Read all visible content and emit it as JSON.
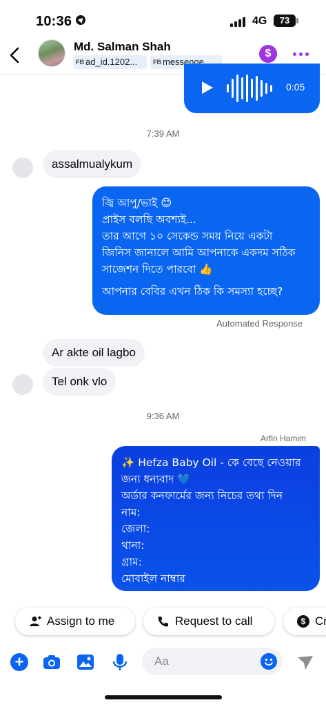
{
  "status_bar": {
    "time": "10:36",
    "network": "4G",
    "battery": "73"
  },
  "header": {
    "contact_name": "Md. Salman Shah",
    "tags": [
      {
        "prefix": "FB",
        "text": "ad_id.1202..."
      },
      {
        "prefix": "FB",
        "text": "messenge..."
      }
    ],
    "accent_color": "#a033e0"
  },
  "audio_message": {
    "duration": "0:05"
  },
  "timestamps": [
    "7:39 AM",
    "9:36 AM"
  ],
  "messages": {
    "incoming_1": "assalmualykum",
    "automated": {
      "lines": [
        "জ্বি আপু/ভাই 😊",
        "প্রাইস বলছি অবশ্যই...",
        "তার আগে ১০ সেকেন্ড সময় নিয়ে একটা",
        "জিনিস জানালে আমি আপনাকে একদম সঠিক",
        "সাজেশন দিতে পারবো 👍",
        "",
        "আপনার বেবির এখন ঠিক কি সমস্যা হচ্ছে?"
      ],
      "label": "Automated Response"
    },
    "incoming_2": "Ar akte oil lagbo",
    "incoming_3": "Tel onk vlo",
    "sender_name": "Arfin Hamim",
    "order": {
      "lines": [
        "✨ Hefza Baby Oil - কে বেছে নেওয়ার",
        "জন্য ধন্যবাদ 💙",
        "অর্ডার কনফার্মের জন্য নিচের তথ্য দিন",
        "নাম:",
        "জেলা:",
        "থানা:",
        "গ্রাম:",
        "মোবাইল নাম্বার"
      ]
    }
  },
  "actions": {
    "assign": "Assign to me",
    "request_call": "Request to call",
    "third": "Cr"
  },
  "composer": {
    "placeholder": "Aa"
  },
  "colors": {
    "brand_blue": "#0a66f0",
    "bubble_grey": "#f0f2f5"
  }
}
